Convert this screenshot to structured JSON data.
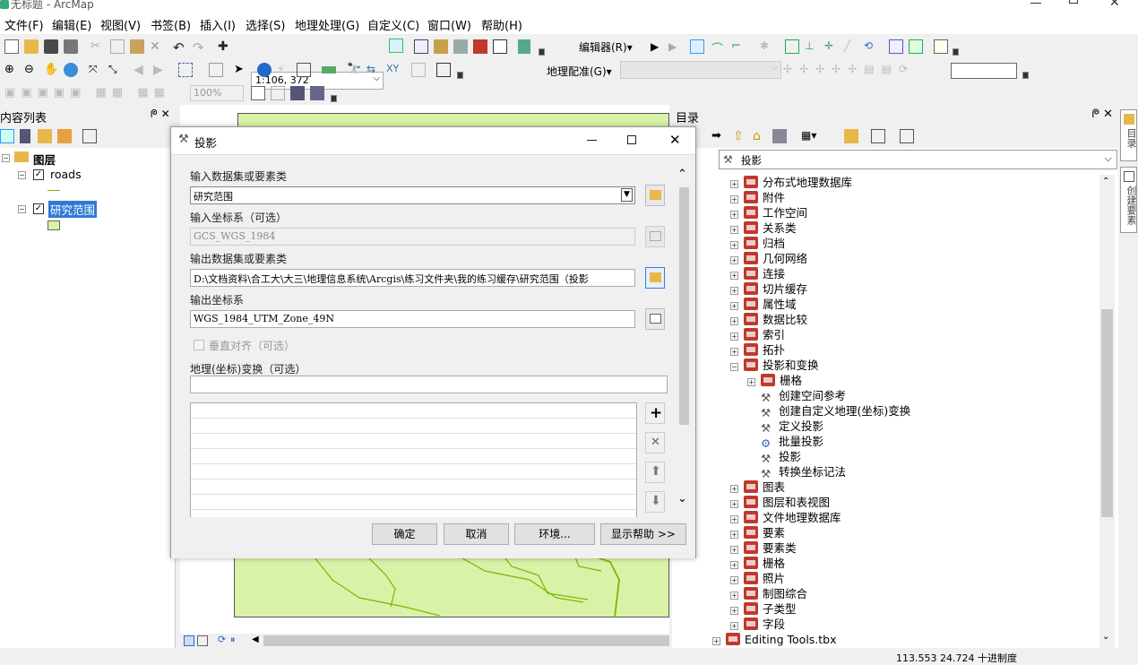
{
  "window": {
    "title": "无标题 - ArcMap"
  },
  "menu": [
    "文件(F)",
    "编辑(E)",
    "视图(V)",
    "书签(B)",
    "插入(I)",
    "选择(S)",
    "地理处理(G)",
    "自定义(C)",
    "窗口(W)",
    "帮助(H)"
  ],
  "toolbar": {
    "scale": "1:106, 372",
    "editor_label": "编辑器(R)▾",
    "georef_label": "地理配准(G)▾",
    "zoom_value": "100%"
  },
  "toc": {
    "title": "内容列表",
    "pin": "ᖘ ✕",
    "layers_root": "图层",
    "layers": [
      "roads",
      "研究范围"
    ]
  },
  "catalog": {
    "title": "目录",
    "location_value": "投影",
    "tree": [
      {
        "label": "分布式地理数据库",
        "indent": 0,
        "kind": "toolset",
        "exp": "+"
      },
      {
        "label": "附件",
        "indent": 0,
        "kind": "toolset",
        "exp": "+"
      },
      {
        "label": "工作空间",
        "indent": 0,
        "kind": "toolset",
        "exp": "+"
      },
      {
        "label": "关系类",
        "indent": 0,
        "kind": "toolset",
        "exp": "+"
      },
      {
        "label": "归档",
        "indent": 0,
        "kind": "toolset",
        "exp": "+"
      },
      {
        "label": "几何网络",
        "indent": 0,
        "kind": "toolset",
        "exp": "+"
      },
      {
        "label": "连接",
        "indent": 0,
        "kind": "toolset",
        "exp": "+"
      },
      {
        "label": "切片缓存",
        "indent": 0,
        "kind": "toolset",
        "exp": "+"
      },
      {
        "label": "属性域",
        "indent": 0,
        "kind": "toolset",
        "exp": "+"
      },
      {
        "label": "数据比较",
        "indent": 0,
        "kind": "toolset",
        "exp": "+"
      },
      {
        "label": "索引",
        "indent": 0,
        "kind": "toolset",
        "exp": "+"
      },
      {
        "label": "拓扑",
        "indent": 0,
        "kind": "toolset",
        "exp": "+"
      },
      {
        "label": "投影和变换",
        "indent": 0,
        "kind": "toolset",
        "exp": "−"
      },
      {
        "label": "栅格",
        "indent": 1,
        "kind": "toolset",
        "exp": "+"
      },
      {
        "label": "创建空间参考",
        "indent": 1,
        "kind": "tool",
        "exp": ""
      },
      {
        "label": "创建自定义地理(坐标)变换",
        "indent": 1,
        "kind": "tool",
        "exp": ""
      },
      {
        "label": "定义投影",
        "indent": 1,
        "kind": "tool",
        "exp": ""
      },
      {
        "label": "批量投影",
        "indent": 1,
        "kind": "script",
        "exp": ""
      },
      {
        "label": "投影",
        "indent": 1,
        "kind": "tool",
        "exp": ""
      },
      {
        "label": "转换坐标记法",
        "indent": 1,
        "kind": "tool",
        "exp": ""
      },
      {
        "label": "图表",
        "indent": 0,
        "kind": "toolset",
        "exp": "+"
      },
      {
        "label": "图层和表视图",
        "indent": 0,
        "kind": "toolset",
        "exp": "+"
      },
      {
        "label": "文件地理数据库",
        "indent": 0,
        "kind": "toolset",
        "exp": "+"
      },
      {
        "label": "要素",
        "indent": 0,
        "kind": "toolset",
        "exp": "+"
      },
      {
        "label": "要素类",
        "indent": 0,
        "kind": "toolset",
        "exp": "+"
      },
      {
        "label": "栅格",
        "indent": 0,
        "kind": "toolset",
        "exp": "+"
      },
      {
        "label": "照片",
        "indent": 0,
        "kind": "toolset",
        "exp": "+"
      },
      {
        "label": "制图综合",
        "indent": 0,
        "kind": "toolset",
        "exp": "+"
      },
      {
        "label": "子类型",
        "indent": 0,
        "kind": "toolset",
        "exp": "+"
      },
      {
        "label": "字段",
        "indent": 0,
        "kind": "toolset",
        "exp": "+"
      },
      {
        "label": "Editing Tools.tbx",
        "indent": -1,
        "kind": "toolbox",
        "exp": "+"
      }
    ]
  },
  "side_tabs": [
    "目录",
    "创建要素"
  ],
  "dialog": {
    "title": "投影",
    "input_label": "输入数据集或要素类",
    "input_value": "研究范围",
    "in_cs_label": "输入坐标系（可选）",
    "in_cs_value": "GCS_WGS_1984",
    "output_label": "输出数据集或要素类",
    "output_value": "D:\\文档资料\\合工大\\大三\\地理信息系统\\Arcgis\\练习文件夹\\我的练习缓存\\研究范围（投影",
    "out_cs_label": "输出坐标系",
    "out_cs_value": "WGS_1984_UTM_Zone_49N",
    "vertical_label": "垂直对齐（可选）",
    "geo_transform_label": "地理(坐标)变换（可选）",
    "ok": "确定",
    "cancel": "取消",
    "env": "环境...",
    "help": "显示帮助 >>"
  },
  "status": {
    "coords": "113.553  24.724  十进制度"
  }
}
